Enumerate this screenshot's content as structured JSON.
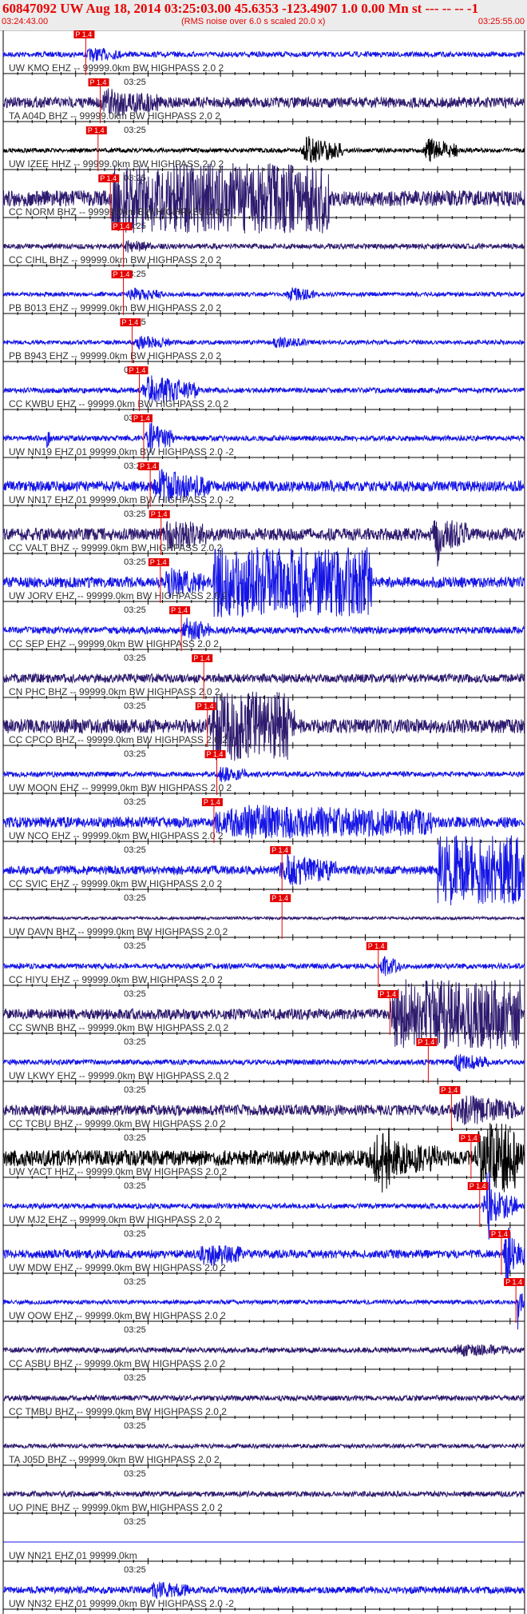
{
  "header": {
    "title": "60847092 UW Aug 18, 2014 03:25:03.00   45.6353 -123.4907  1.0 0.00 Mn st --- -- --   -1",
    "subtitle": "(RMS noise over 6.0 s scaled 20.0 x)",
    "time_start": "03:24:43.00",
    "time_end": "03:25:55.00"
  },
  "chart_data": {
    "type": "line",
    "plot": "seismogram-record-section",
    "x_start": "03:24:43.00",
    "x_end": "03:25:55.00",
    "x_range_s": [
      0,
      72
    ],
    "time_tick_label": "03:25",
    "pick_label": "P 1.4",
    "colors": {
      "blue": "#1515e6",
      "dark": "#2e1a6e",
      "black": "#000000",
      "pick": "#e60000"
    },
    "traces": [
      {
        "label": "UW KMO EHZ -- 99999.0km BW  HIGHPASS  2.0  2",
        "pick_s": 11.4,
        "color": "blue",
        "amp": 0.15,
        "events": [
          {
            "t": 11.4,
            "a": 0.35,
            "d": 5
          }
        ]
      },
      {
        "label": "TA A04D BHZ -- 99999.0km BW  HIGHPASS  2.0  2",
        "pick_s": 13.4,
        "color": "dark",
        "amp": 0.3,
        "events": [
          {
            "t": 13.4,
            "a": 0.8,
            "d": 8
          }
        ]
      },
      {
        "label": "UW IZEE HHZ -- 99999.0km BW  HIGHPASS  2.0  2",
        "pick_s": 13.1,
        "color": "black",
        "amp": 0.12,
        "events": [
          {
            "t": 41,
            "a": 0.9,
            "d": 6
          },
          {
            "t": 58,
            "a": 0.8,
            "d": 5
          }
        ]
      },
      {
        "label": "CC NORM BHZ -- 99999.0km BW  HIGHPASS  2.0  2",
        "pick_s": 14.8,
        "color": "dark",
        "amp": 0.45,
        "events": [
          {
            "t": 15,
            "a": 1.0,
            "d": 30
          }
        ]
      },
      {
        "label": "CC CIHL BHZ -- 99999.0km BW  HIGHPASS  2.0  2",
        "pick_s": 16.6,
        "color": "dark",
        "amp": 0.15,
        "events": [
          {
            "t": 16.6,
            "a": 0.3,
            "d": 4
          }
        ]
      },
      {
        "label": "PB B013 EHZ -- 99999.0km BW  HIGHPASS  2.0  2",
        "pick_s": 16.6,
        "color": "blue",
        "amp": 0.12,
        "events": [
          {
            "t": 17,
            "a": 0.35,
            "d": 5
          },
          {
            "t": 39,
            "a": 0.4,
            "d": 4
          }
        ]
      },
      {
        "label": "PB B943 EHZ -- 99999.0km BW  HIGHPASS  2.0  2",
        "pick_s": 17.8,
        "color": "blue",
        "amp": 0.12,
        "events": [
          {
            "t": 18,
            "a": 0.4,
            "d": 5
          },
          {
            "t": 37,
            "a": 0.3,
            "d": 5
          }
        ]
      },
      {
        "label": "CC KWBU EHZ -- 99999.0km BW  HIGHPASS  2.0  2",
        "pick_s": 18.8,
        "color": "blue",
        "amp": 0.15,
        "events": [
          {
            "t": 19,
            "a": 1.0,
            "d": 8
          }
        ]
      },
      {
        "label": "UW NN19 EHZ 01 99999.0km BW  HIGHPASS  2.0  -2",
        "pick_s": 19.4,
        "color": "blue",
        "amp": 0.15,
        "events": [
          {
            "t": 19.5,
            "a": 1.0,
            "d": 4
          },
          {
            "t": 6,
            "a": 0.8,
            "d": 0.6
          }
        ]
      },
      {
        "label": "UW NN17 EHZ 01 99999.0km BW  HIGHPASS  2.0  -2",
        "pick_s": 20.3,
        "color": "blue",
        "amp": 0.3,
        "events": [
          {
            "t": 20.5,
            "a": 0.9,
            "d": 8
          },
          {
            "t": 45,
            "a": 0.4,
            "d": 0.5
          }
        ]
      },
      {
        "label": "CC VALT BHZ -- 99999.0km BW  HIGHPASS  2.0  2",
        "pick_s": 21.8,
        "color": "dark",
        "amp": 0.35,
        "events": [
          {
            "t": 22,
            "a": 0.8,
            "d": 6
          },
          {
            "t": 59,
            "a": 1.0,
            "d": 5
          }
        ]
      },
      {
        "label": "UW JORV EHZ -- 99999.0km BW  HIGHPASS  2.0  2",
        "pick_s": 21.7,
        "color": "blue",
        "amp": 0.3,
        "events": [
          {
            "t": 22,
            "a": 0.7,
            "d": 6
          },
          {
            "t": 29,
            "a": 2.0,
            "d": 22
          }
        ]
      },
      {
        "label": "CC SEP EHZ -- 99999.0km BW  HIGHPASS  2.0  2",
        "pick_s": 24.6,
        "color": "blue",
        "amp": 0.2,
        "events": [
          {
            "t": 24.6,
            "a": 0.7,
            "d": 4
          }
        ]
      },
      {
        "label": "CN PHC BHZ -- 99999.0km BW  HIGHPASS  2.0  2",
        "pick_s": 27.7,
        "color": "dark",
        "amp": 0.25,
        "events": []
      },
      {
        "label": "CC CPCO BHZ -- 99999.0km BW  HIGHPASS  2.0  2",
        "pick_s": 28.2,
        "color": "dark",
        "amp": 0.4,
        "events": [
          {
            "t": 28.3,
            "a": 0.7,
            "d": 12
          }
        ]
      },
      {
        "label": "UW MOON EHZ -- 99999.0km BW  HIGHPASS  2.0  2",
        "pick_s": 29.5,
        "color": "blue",
        "amp": 0.15,
        "events": [
          {
            "t": 29.5,
            "a": 0.4,
            "d": 4
          }
        ]
      },
      {
        "label": "UW NCO EHZ -- 99999.0km BW  HIGHPASS  2.0  2",
        "pick_s": 29.1,
        "color": "blue",
        "amp": 0.3,
        "events": [
          {
            "t": 29.2,
            "a": 0.5,
            "d": 30
          }
        ]
      },
      {
        "label": "CC SVIC EHZ -- 99999.0km BW  HIGHPASS  2.0  2",
        "pick_s": 38.5,
        "color": "blue",
        "amp": 0.25,
        "events": [
          {
            "t": 38,
            "a": 0.9,
            "d": 8
          },
          {
            "t": 60,
            "a": 2.0,
            "d": 13
          }
        ]
      },
      {
        "label": "UW DAVN BHZ -- 99999.0km BW  HIGHPASS  2.0  2",
        "pick_s": 38.5,
        "color": "dark",
        "amp": 0.08,
        "events": []
      },
      {
        "label": "CC HIYU EHZ -- 99999.0km BW  HIGHPASS  2.0  2",
        "pick_s": 51.8,
        "color": "blue",
        "amp": 0.15,
        "events": [
          {
            "t": 52,
            "a": 0.6,
            "d": 3
          }
        ]
      },
      {
        "label": "CC SWNB BHZ -- 99999.0km BW  HIGHPASS  2.0  2",
        "pick_s": 53.4,
        "color": "dark",
        "amp": 0.3,
        "events": [
          {
            "t": 53.5,
            "a": 1.0,
            "d": 18
          }
        ]
      },
      {
        "label": "UW LKWY EHZ -- 99999.0km BW  HIGHPASS  2.0  2",
        "pick_s": 58.7,
        "color": "blue",
        "amp": 0.15,
        "events": [
          {
            "t": 62,
            "a": 0.5,
            "d": 5
          }
        ]
      },
      {
        "label": "CC TCBU BHZ -- 99999.0km BW  HIGHPASS  2.0  2",
        "pick_s": 61.9,
        "color": "dark",
        "amp": 0.3,
        "events": [
          {
            "t": 62,
            "a": 0.8,
            "d": 9
          }
        ]
      },
      {
        "label": "UW YACT HHZ -- 99999.0km BW  HIGHPASS  2.0  2",
        "pick_s": 64.6,
        "color": "black",
        "amp": 0.45,
        "events": [
          {
            "t": 50,
            "a": 0.9,
            "d": 10
          },
          {
            "t": 65,
            "a": 1.6,
            "d": 7
          }
        ]
      },
      {
        "label": "UW MJ2 EHZ -- 99999.0km BW  HIGHPASS  2.0  2",
        "pick_s": 65.8,
        "color": "blue",
        "amp": 0.15,
        "events": [
          {
            "t": 66,
            "a": 1.2,
            "d": 5
          }
        ]
      },
      {
        "label": "UW MDW EHZ -- 99999.0km BW  HIGHPASS  2.0  2",
        "pick_s": 68.8,
        "color": "blue",
        "amp": 0.25,
        "events": [
          {
            "t": 27,
            "a": 0.6,
            "d": 6
          },
          {
            "t": 69,
            "a": 1.2,
            "d": 3
          }
        ]
      },
      {
        "label": "UW OOW EHZ -- 99999.0km BW  HIGHPASS  2.0  2",
        "pick_s": 70.8,
        "color": "blue",
        "amp": 0.12,
        "events": [
          {
            "t": 71,
            "a": 1.3,
            "d": 1
          }
        ]
      },
      {
        "label": "CC ASBU BHZ -- 99999.0km BW  HIGHPASS  2.0  2",
        "pick_s": null,
        "color": "dark",
        "amp": 0.15,
        "events": [
          {
            "t": 62,
            "a": 0.3,
            "d": 8
          }
        ]
      },
      {
        "label": "CC TMBU BHZ -- 99999.0km BW  HIGHPASS  2.0  2",
        "pick_s": null,
        "color": "dark",
        "amp": 0.15,
        "events": []
      },
      {
        "label": "TA J05D BHZ -- 99999.0km BW  HIGHPASS  2.0  2",
        "pick_s": null,
        "color": "dark",
        "amp": 0.12,
        "events": []
      },
      {
        "label": "UO PINE BHZ -- 99999.0km BW  HIGHPASS  2.0  2",
        "pick_s": null,
        "color": "dark",
        "amp": 0.15,
        "events": []
      },
      {
        "label": "UW NN21 EHZ 01 99999.0km",
        "pick_s": null,
        "color": "blue",
        "amp": 0.0,
        "events": []
      },
      {
        "label": "UW NN32 EHZ 01 99999.0km BW  HIGHPASS  2.0  -2",
        "pick_s": null,
        "color": "blue",
        "amp": 0.2,
        "events": [
          {
            "t": 20,
            "a": 0.4,
            "d": 6
          }
        ]
      }
    ]
  }
}
